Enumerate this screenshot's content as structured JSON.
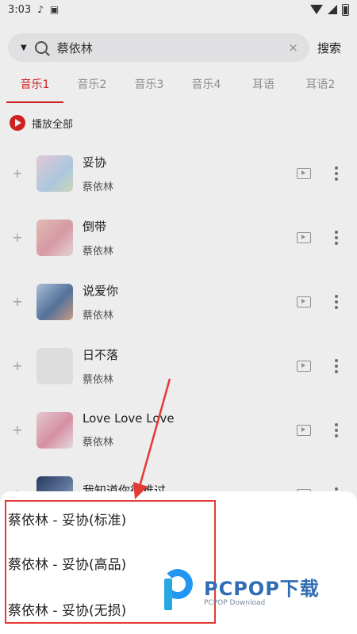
{
  "status_bar": {
    "time": "3:03",
    "icons": [
      "music-note-icon",
      "a-badge-icon",
      "wifi-icon",
      "signal-icon",
      "battery-icon"
    ]
  },
  "search": {
    "query": "蔡依林",
    "button_label": "搜索"
  },
  "tabs": [
    {
      "label": "音乐1",
      "active": true
    },
    {
      "label": "音乐2"
    },
    {
      "label": "音乐3"
    },
    {
      "label": "音乐4"
    },
    {
      "label": "耳语"
    },
    {
      "label": "耳语2"
    }
  ],
  "play_all": {
    "label": "播放全部"
  },
  "songs": [
    {
      "title": "妥协",
      "artist": "蔡依林"
    },
    {
      "title": "倒带",
      "artist": "蔡依林"
    },
    {
      "title": "说爱你",
      "artist": "蔡依林"
    },
    {
      "title": "日不落",
      "artist": "蔡依林"
    },
    {
      "title": "Love Love Love",
      "artist": "蔡依林"
    },
    {
      "title": "我知道你很难过",
      "artist": ""
    }
  ],
  "quality_options": [
    "蔡依林 - 妥协(标准)",
    "蔡依林 - 妥协(高品)",
    "蔡依林 - 妥协(无损)"
  ],
  "watermark": {
    "main": "PCPOP下载",
    "sub": "PCPOP Download"
  },
  "colors": {
    "accent": "#e02424",
    "highlight": "#e53935",
    "watermark": "#2f6db5"
  }
}
